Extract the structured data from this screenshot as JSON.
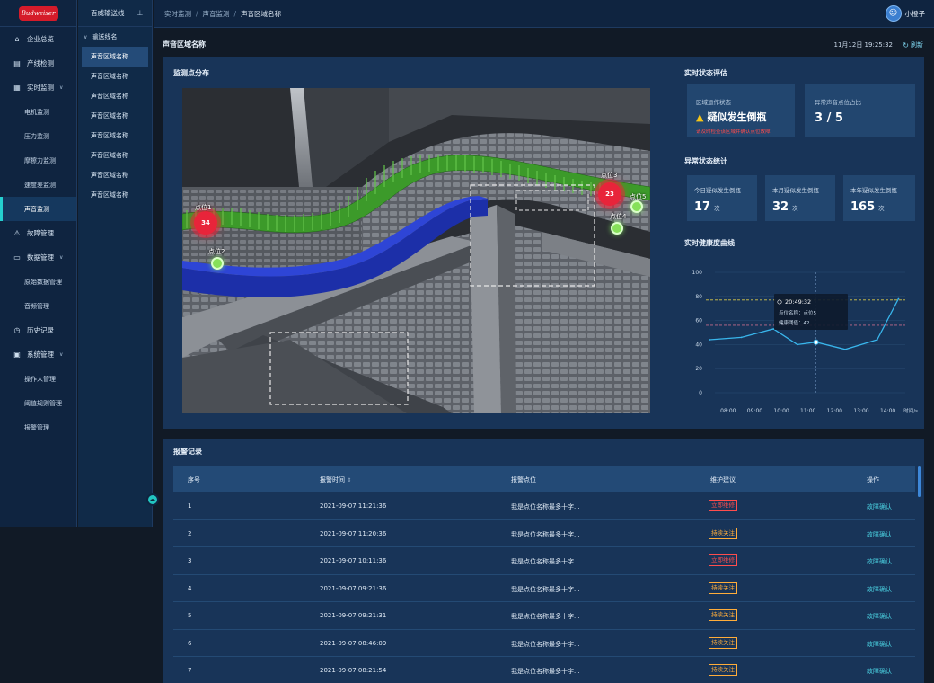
{
  "logo": {
    "text": "Budweiser"
  },
  "sidebar": {
    "items": [
      {
        "label": "企业总览",
        "icon": "home-icon",
        "type": "item"
      },
      {
        "label": "产线检测",
        "icon": "chart-icon",
        "type": "item"
      },
      {
        "label": "实时监测",
        "icon": "list-icon",
        "type": "group",
        "expanded": true
      },
      {
        "label": "电机监测",
        "type": "sub"
      },
      {
        "label": "压力监测",
        "type": "sub"
      },
      {
        "label": "摩擦力监测",
        "type": "sub"
      },
      {
        "label": "速度差监测",
        "type": "sub"
      },
      {
        "label": "声音监测",
        "type": "sub",
        "active": true
      },
      {
        "label": "故障管理",
        "icon": "warning-icon",
        "type": "item"
      },
      {
        "label": "数据管理",
        "icon": "monitor-icon",
        "type": "group",
        "expanded": true
      },
      {
        "label": "原始数据管理",
        "type": "sub"
      },
      {
        "label": "音频管理",
        "type": "sub"
      },
      {
        "label": "历史记录",
        "icon": "clock-icon",
        "type": "item"
      },
      {
        "label": "系统管理",
        "icon": "briefcase-icon",
        "type": "group",
        "expanded": true
      },
      {
        "label": "操作人管理",
        "type": "sub"
      },
      {
        "label": "阈值规则管理",
        "type": "sub"
      },
      {
        "label": "报警管理",
        "type": "sub"
      }
    ]
  },
  "panel2": {
    "title": "百威输送线",
    "group": "输送线名",
    "areas": [
      "声音区域名称",
      "声音区域名称",
      "声音区域名称",
      "声音区域名称",
      "声音区域名称",
      "声音区域名称",
      "声音区域名称",
      "声音区域名称"
    ]
  },
  "topbar": {
    "breadcrumbs": [
      "实时监测",
      "声音监测",
      "声音区域名称"
    ],
    "user_name": "小橙子"
  },
  "header": {
    "title": "声音区域名称",
    "timestamp": "11月12日 19:25:32",
    "refresh_label": "刷新"
  },
  "map": {
    "title": "监测点分布",
    "points": [
      {
        "label": "点位1",
        "value": "34",
        "status": "alarm"
      },
      {
        "label": "点位2",
        "value": "",
        "status": "normal"
      },
      {
        "label": "点位3",
        "value": "23",
        "status": "alarm"
      },
      {
        "label": "点位4",
        "value": "",
        "status": "normal"
      },
      {
        "label": "点位5",
        "value": "",
        "status": "normal"
      }
    ]
  },
  "evaluation": {
    "title": "实时状态评估",
    "status_label": "区域运作状态",
    "status_value": "疑似发生倒瓶",
    "hint": "请及时检查该区域并确认点位故障",
    "ratio_label": "异常声音点位占比",
    "ratio_value": "3 / 5"
  },
  "stats": {
    "title": "异常状态统计",
    "items": [
      {
        "label": "今日疑似发生倒瓶",
        "value": "17",
        "unit": "次"
      },
      {
        "label": "本月疑似发生倒瓶",
        "value": "32",
        "unit": "次"
      },
      {
        "label": "本年疑似发生倒瓶",
        "value": "165",
        "unit": "次"
      }
    ]
  },
  "chart_data": {
    "type": "line",
    "title": "实时健康度曲线",
    "x": [
      "08:00",
      "09:00",
      "10:00",
      "11:00",
      "12:00",
      "13:00",
      "14:00"
    ],
    "x_unit": "时间/s",
    "ylim": [
      0,
      100
    ],
    "yticks": [
      0,
      20,
      40,
      60,
      80,
      100
    ],
    "points": [
      {
        "x": 7.3,
        "y": 44
      },
      {
        "x": 8.5,
        "y": 46
      },
      {
        "x": 9.7,
        "y": 53
      },
      {
        "x": 10.6,
        "y": 40
      },
      {
        "x": 11.3,
        "y": 42
      },
      {
        "x": 12.4,
        "y": 36
      },
      {
        "x": 13.6,
        "y": 44
      },
      {
        "x": 14.4,
        "y": 78
      }
    ],
    "thresholds": [
      {
        "y": 77,
        "color": "#d8c84a"
      },
      {
        "y": 56,
        "color": "#c06a8a"
      }
    ],
    "tooltip": {
      "time": "20:49:32",
      "name_label": "点位名称：点位5",
      "value_label": "健康阈值：42"
    },
    "line_color": "#39b6ec",
    "grid": true
  },
  "alarms": {
    "title": "报警记录",
    "columns": [
      "序号",
      "报警时间",
      "报警点位",
      "维护建议",
      "操作"
    ],
    "sort_icon": "⇕",
    "rows": [
      {
        "no": "1",
        "time": "2021-09-07  11:21:36",
        "point": "我是点位名称最多十字...",
        "advice": "立即维修",
        "level": "red",
        "action": "故障确认"
      },
      {
        "no": "2",
        "time": "2021-09-07  11:20:36",
        "point": "我是点位名称最多十字...",
        "advice": "持续关注",
        "level": "orange",
        "action": "故障确认"
      },
      {
        "no": "3",
        "time": "2021-09-07  10:11:36",
        "point": "我是点位名称最多十字...",
        "advice": "立即维修",
        "level": "red",
        "action": "故障确认"
      },
      {
        "no": "4",
        "time": "2021-09-07  09:21:36",
        "point": "我是点位名称最多十字...",
        "advice": "持续关注",
        "level": "orange",
        "action": "故障确认"
      },
      {
        "no": "5",
        "time": "2021-09-07  09:21:31",
        "point": "我是点位名称最多十字...",
        "advice": "持续关注",
        "level": "orange",
        "action": "故障确认"
      },
      {
        "no": "6",
        "time": "2021-09-07  08:46:09",
        "point": "我是点位名称最多十字...",
        "advice": "持续关注",
        "level": "orange",
        "action": "故障确认"
      },
      {
        "no": "7",
        "time": "2021-09-07  08:21:54",
        "point": "我是点位名称最多十字...",
        "advice": "持续关注",
        "level": "orange",
        "action": "故障确认"
      }
    ]
  }
}
